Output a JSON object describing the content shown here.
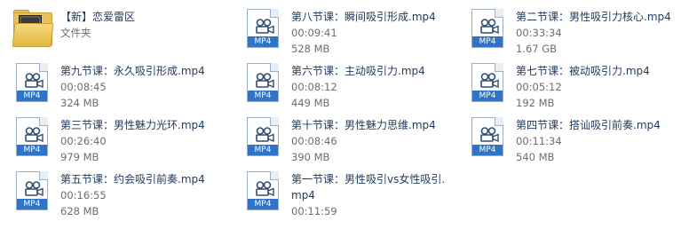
{
  "folder": {
    "name": "【新】恋爱雷区",
    "type": "文件夹",
    "icon": "folder-icon"
  },
  "files": [
    {
      "name": "第八节课：瞬间吸引形成.mp4",
      "duration": "00:09:41",
      "size": "528 MB"
    },
    {
      "name": "第二节课：男性吸引力核心.mp4",
      "duration": "00:33:34",
      "size": "1.67 GB"
    },
    {
      "name": "第九节课：永久吸引形成.mp4",
      "duration": "00:08:45",
      "size": "324 MB"
    },
    {
      "name": "第六节课：主动吸引力.mp4",
      "duration": "00:08:12",
      "size": "449 MB"
    },
    {
      "name": "第七节课：被动吸引力.mp4",
      "duration": "00:05:12",
      "size": "192 MB"
    },
    {
      "name": "第三节课：男性魅力光环.mp4",
      "duration": "00:26:40",
      "size": "979 MB"
    },
    {
      "name": "第十节课：男性魅力思维.mp4",
      "duration": "00:08:46",
      "size": "390 MB"
    },
    {
      "name": "第四节课：搭讪吸引前奏.mp4",
      "duration": "00:11:34",
      "size": "540 MB"
    },
    {
      "name": "第五节课：约会吸引前奏.mp4",
      "duration": "00:16:55",
      "size": "628 MB"
    },
    {
      "name": "第一节课：男性吸引vs女性吸引.mp4",
      "duration": "00:11:59",
      "size": ""
    }
  ],
  "file_icon_label": "MP4",
  "colors": {
    "band": "#2f74c6",
    "name_text": "#1e395b",
    "meta_text": "#6d6d6d"
  }
}
